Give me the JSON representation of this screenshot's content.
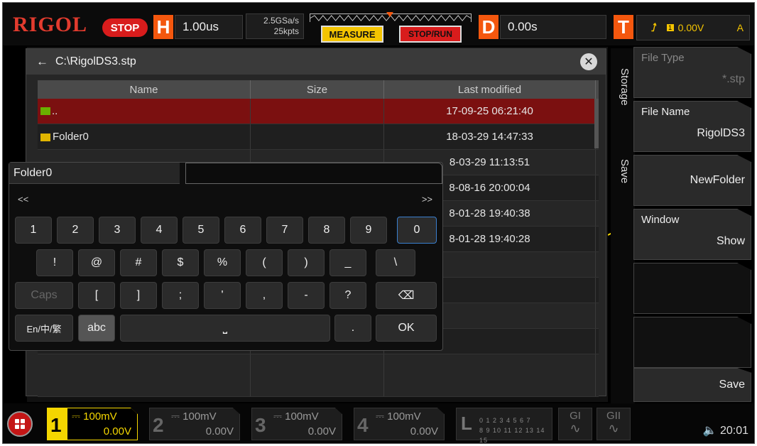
{
  "topbar": {
    "brand": "RIGOL",
    "run_state": "STOP",
    "horizontal_label": "H",
    "timebase": "1.00us",
    "sample_rate": "2.5GSa/s",
    "memory_depth": "25kpts",
    "measure_label": "MEASURE",
    "stoprun_label": "STOP/RUN",
    "delay_label": "D",
    "delay_value": "0.00s",
    "trigger_label": "T",
    "trigger_source": "1",
    "trigger_level": "0.00V",
    "trigger_mode": "A"
  },
  "dialog": {
    "path": "C:\\RigolDS3.stp",
    "columns": [
      "Name",
      "Size",
      "Last modified"
    ],
    "rows": [
      {
        "name": "..",
        "size": "",
        "modified": "17-09-25 06:21:40"
      },
      {
        "name": "Folder0",
        "size": "",
        "modified": "18-03-29 14:47:33"
      },
      {
        "name": "",
        "size": "",
        "modified": "8-03-29 11:13:51"
      },
      {
        "name": "",
        "size": "",
        "modified": "8-08-16 20:00:04"
      },
      {
        "name": "",
        "size": "",
        "modified": "8-01-28 19:40:38"
      },
      {
        "name": "",
        "size": "",
        "modified": "8-01-28 19:40:28"
      }
    ]
  },
  "keyboard": {
    "input_value": "Folder0",
    "prev": "<<",
    "next": ">>",
    "row1": [
      "1",
      "2",
      "3",
      "4",
      "5",
      "6",
      "7",
      "8",
      "9",
      "0"
    ],
    "row2": [
      "!",
      "@",
      "#",
      "$",
      "%",
      "(",
      ")",
      "_",
      "\\"
    ],
    "row3": [
      "Caps",
      "[",
      "]",
      ";",
      "'",
      ",",
      "-",
      "?",
      "⌫"
    ],
    "lang": "En/中/繁",
    "abc": "abc",
    "space": "⎵",
    "dot": ".",
    "ok": "OK"
  },
  "softkeys": {
    "tab_storage": "Storage",
    "tab_save": "Save",
    "file_type_label": "File Type",
    "file_type_value": "*.stp",
    "file_name_label": "File Name",
    "file_name_value": "RigolDS3",
    "new_folder": "NewFolder",
    "window_label": "Window",
    "window_value": "Show",
    "save": "Save"
  },
  "channels": [
    {
      "num": "1",
      "scale": "100mV",
      "offset": "0.00V"
    },
    {
      "num": "2",
      "scale": "100mV",
      "offset": "0.00V"
    },
    {
      "num": "3",
      "scale": "100mV",
      "offset": "0.00V"
    },
    {
      "num": "4",
      "scale": "100mV",
      "offset": "0.00V"
    }
  ],
  "la": {
    "label": "L",
    "row1": "0 1 2 3  4 5 6 7",
    "row2": "8 9 10 11 12 13 14 15"
  },
  "generators": [
    {
      "label": "GI",
      "wave": "∿"
    },
    {
      "label": "GII",
      "wave": "∿"
    }
  ],
  "status": {
    "time": "20:01",
    "speaker": "🔈"
  },
  "colors": {
    "accent": "#f4570e",
    "ch1": "#f4d600",
    "selected_row": "#7b1010"
  }
}
